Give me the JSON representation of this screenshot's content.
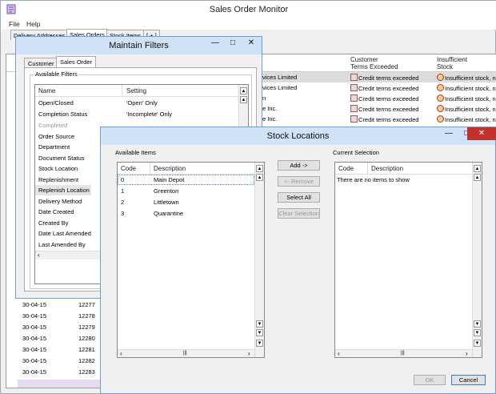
{
  "main": {
    "title": "Sales Order Monitor",
    "menu": [
      "File",
      "Help"
    ],
    "tabs": [
      "Delivery Addresses",
      "Sales Orders",
      "Stock Items",
      "[ + ]"
    ],
    "grid": {
      "headers": {
        "customer_terms": "Customer\nTerms Exceeded",
        "insufficient_stock": "Insufficient\nStock"
      },
      "top_rows": [
        {
          "customer": "vices Limited",
          "terms": "Credit terms exceeded",
          "stock": "Insufficient stock, no"
        },
        {
          "customer": "vices Limited",
          "terms": "Credit terms exceeded",
          "stock": "Insufficient stock, no"
        },
        {
          "customer": "n",
          "terms": "Credit terms exceeded",
          "stock": "Insufficient stock, no"
        },
        {
          "customer": "e Inc.",
          "terms": "Credit terms exceeded",
          "stock": "Insufficient stock, no"
        },
        {
          "customer": "e Inc.",
          "terms": "Credit terms exceeded",
          "stock": "Insufficient stock, no"
        }
      ],
      "bottom_rows": [
        {
          "date": "30-04-15",
          "number": "12277"
        },
        {
          "date": "30-04-15",
          "number": "12278"
        },
        {
          "date": "30-04-15",
          "number": "12279"
        },
        {
          "date": "30-04-15",
          "number": "12280"
        },
        {
          "date": "30-04-15",
          "number": "12281"
        },
        {
          "date": "30-04-15",
          "number": "12282"
        },
        {
          "date": "30-04-15",
          "number": "12283"
        }
      ]
    }
  },
  "maintain_filters": {
    "title": "Maintain Filters",
    "tabs": [
      "Customer",
      "Sales Order"
    ],
    "group_label": "Available Filters",
    "columns": {
      "name": "Name",
      "setting": "Setting"
    },
    "rows": [
      {
        "name": "Open/Closed",
        "setting": "'Open' Only"
      },
      {
        "name": "Completion Status",
        "setting": "'Incomplete' Only"
      },
      {
        "name": "Completed",
        "setting": ""
      },
      {
        "name": "Order Source",
        "setting": ""
      },
      {
        "name": "Department",
        "setting": ""
      },
      {
        "name": "Document Status",
        "setting": ""
      },
      {
        "name": "Stock Location",
        "setting": ""
      },
      {
        "name": "Replenishment",
        "setting": ""
      },
      {
        "name": "Replenish Location",
        "setting": ""
      },
      {
        "name": "Delivery Method",
        "setting": ""
      },
      {
        "name": "Date Created",
        "setting": ""
      },
      {
        "name": "Created By",
        "setting": ""
      },
      {
        "name": "Date Last Amended",
        "setting": ""
      },
      {
        "name": "Last Amended By",
        "setting": ""
      }
    ]
  },
  "stock_locations": {
    "title": "Stock Locations",
    "available_label": "Available Items",
    "current_label": "Current Selection",
    "columns": {
      "code": "Code",
      "description": "Description"
    },
    "available_items": [
      {
        "code": "0",
        "description": "Main Depot"
      },
      {
        "code": "1",
        "description": "Greenton"
      },
      {
        "code": "2",
        "description": "Littletown"
      },
      {
        "code": "3",
        "description": "Quarantine"
      }
    ],
    "empty_text": "There are no items to show",
    "buttons": {
      "add": "Add ->",
      "remove": "<- Remove",
      "select_all": "Select All",
      "clear": "Clear Selection",
      "ok": "OK",
      "cancel": "Cancel"
    }
  }
}
